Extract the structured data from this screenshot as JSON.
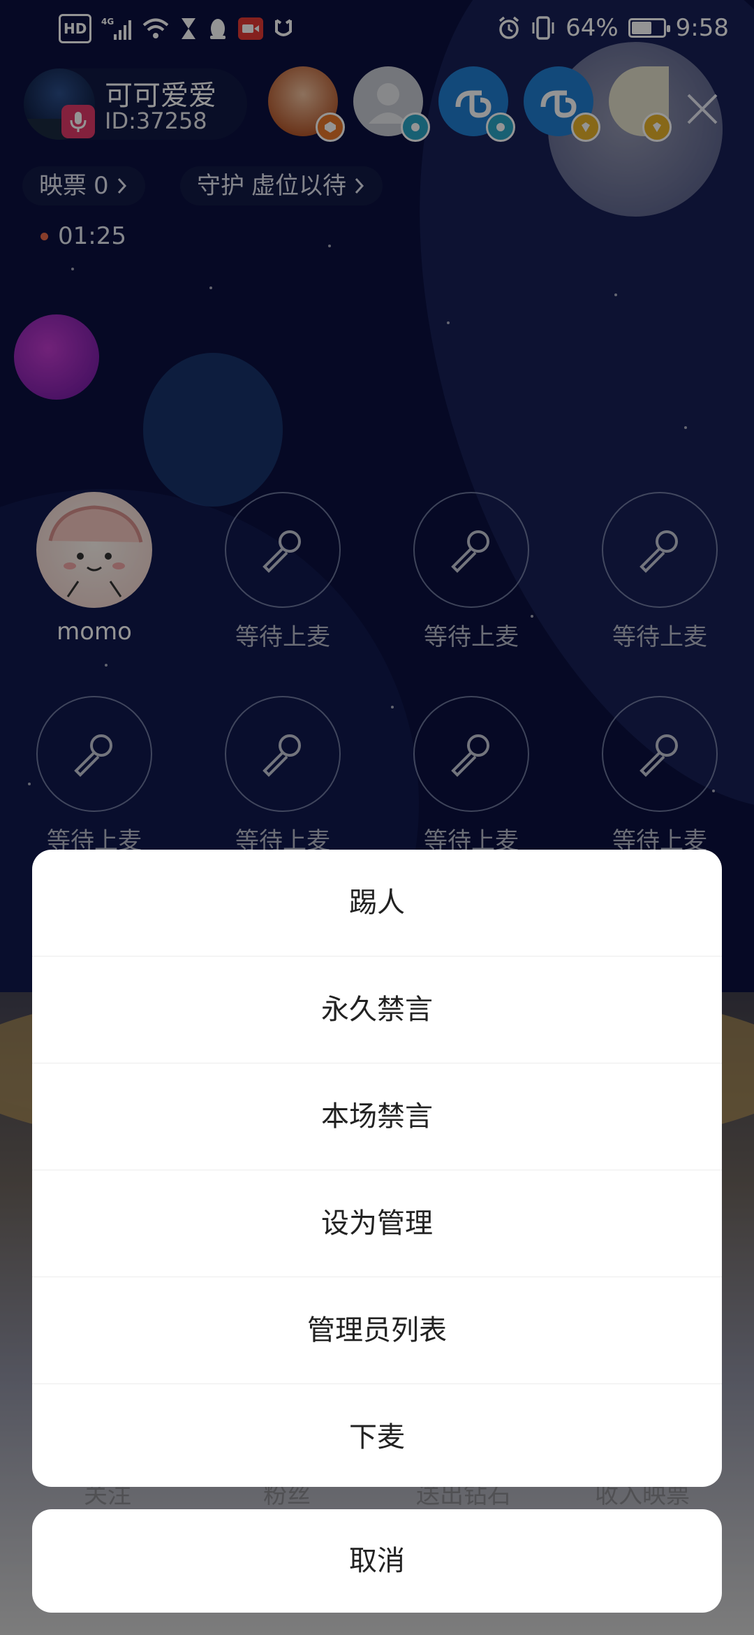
{
  "status_bar": {
    "left_icons": [
      "hd-icon",
      "signal-4g-icon",
      "wifi-icon",
      "hourglass-icon",
      "qq-icon",
      "video-record-icon",
      "security-icon"
    ],
    "network_label": "4G",
    "hd_label": "HD",
    "battery_level": 0.64,
    "battery_text": "64%",
    "time": "9:58"
  },
  "room": {
    "name": "可可爱爱",
    "id_text": "ID:37258"
  },
  "viewers": [
    {
      "name": "viewer-1",
      "badge_color": "#e8782a"
    },
    {
      "name": "viewer-2",
      "badge_color": "#2aa6c7"
    },
    {
      "name": "viewer-3",
      "badge_color": "#2aa6c7"
    },
    {
      "name": "viewer-4",
      "badge_color": "#e9b42a"
    },
    {
      "name": "viewer-5",
      "badge_color": "#e9b42a"
    }
  ],
  "chips": {
    "votes_label": "映票",
    "votes_value": "0",
    "guard_label": "守护",
    "guard_value": "虚位以待"
  },
  "timer": "01:25",
  "seats": [
    {
      "label": "momo",
      "occupied": true
    },
    {
      "label": "等待上麦",
      "occupied": false
    },
    {
      "label": "等待上麦",
      "occupied": false
    },
    {
      "label": "等待上麦",
      "occupied": false
    },
    {
      "label": "等待上麦",
      "occupied": false
    },
    {
      "label": "等待上麦",
      "occupied": false
    },
    {
      "label": "等待上麦",
      "occupied": false
    },
    {
      "label": "等待上麦",
      "occupied": false
    }
  ],
  "stats": [
    "关注",
    "粉丝",
    "送出钻石",
    "收入映票"
  ],
  "action_sheet": {
    "items": [
      "踢人",
      "永久禁言",
      "本场禁言",
      "设为管理",
      "管理员列表",
      "下麦"
    ],
    "cancel": "取消"
  },
  "colors": {
    "background": "#0b1140",
    "sheet_bg": "#ffffff",
    "mic_badge": "#e23a6a",
    "timer_dot": "#e86a4a"
  }
}
